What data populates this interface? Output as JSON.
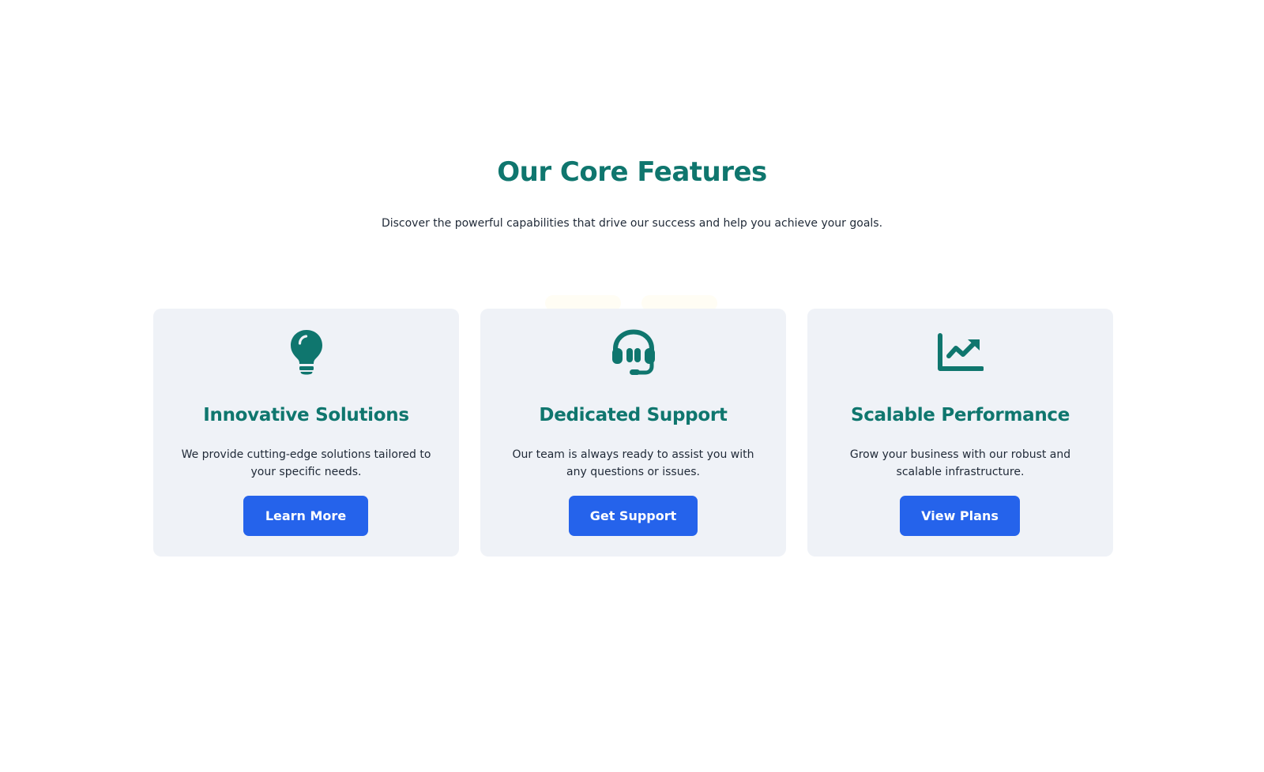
{
  "section": {
    "title": "Our Core Features",
    "subtitle": "Discover the powerful capabilities that drive our success and help you achieve your goals."
  },
  "colors": {
    "accent": "#0f766e",
    "button": "#2563eb",
    "card_bg": "#eff2f7"
  },
  "cards": [
    {
      "icon": "lightbulb-icon",
      "title": "Innovative Solutions",
      "text": "We provide cutting-edge solutions tailored to your specific needs.",
      "button": "Learn More"
    },
    {
      "icon": "headset-icon",
      "title": "Dedicated Support",
      "text": "Our team is always ready to assist you with any questions or issues.",
      "button": "Get Support"
    },
    {
      "icon": "chart-line-icon",
      "title": "Scalable Performance",
      "text": "Grow your business with our robust and scalable infrastructure.",
      "button": "View Plans"
    }
  ]
}
